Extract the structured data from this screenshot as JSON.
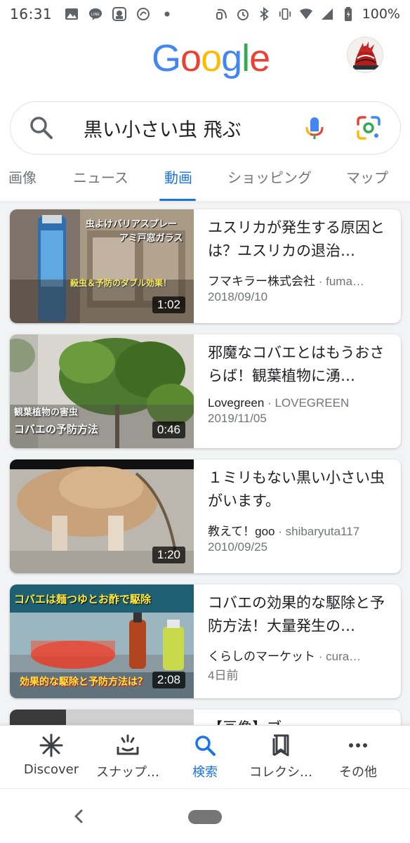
{
  "statusbar": {
    "time": "16:31",
    "battery": "100%"
  },
  "header": {
    "logo": [
      "G",
      "o",
      "o",
      "g",
      "l",
      "e"
    ],
    "logo_colors": [
      "#4285F4",
      "#EA4335",
      "#FBBC05",
      "#4285F4",
      "#34A853",
      "#EA4335"
    ]
  },
  "search": {
    "query": "黒い小さい虫 飛ぶ"
  },
  "tabs": [
    {
      "label": "画像"
    },
    {
      "label": "ニュース"
    },
    {
      "label": "動画",
      "active": true
    },
    {
      "label": "ショッピング"
    },
    {
      "label": "マップ"
    }
  ],
  "results": [
    {
      "title": "ユスリカが発生する原因とは？ユスリカの退治…",
      "source": "フマキラー株式会社",
      "handle": "fuma…",
      "date": "2018/09/10",
      "duration": "1:02",
      "thumb_text": [
        "虫よけバリアスプレー",
        "アミ戸窓ガラス",
        "殺虫＆予防のダブル効果！"
      ]
    },
    {
      "title": "邪魔なコバエとはもうおさらば！観葉植物に湧…",
      "source": "Lovegreen",
      "handle": "LOVEGREEN",
      "date": "2019/11/05",
      "duration": "0:46",
      "thumb_text": [
        "観葉植物の害虫",
        "コバエの予防方法"
      ]
    },
    {
      "title": "１ミリもない黒い小さい虫がいます。",
      "source": "教えて！goo",
      "handle": "shibaryuta117",
      "date": "2010/09/25",
      "duration": "1:20",
      "thumb_text": []
    },
    {
      "title": "コバエの効果的な駆除と予防方法！大量発生の…",
      "source": "くらしのマーケット",
      "handle": "cura…",
      "date": "4日前",
      "duration": "2:08",
      "thumb_text": [
        "コバエは麺つゆとお酢で駆除",
        "効果的な駆除と予防方法は？"
      ]
    },
    {
      "title": "【画像】ブ…",
      "source": "",
      "handle": "",
      "date": "",
      "duration": "",
      "thumb_text": []
    }
  ],
  "bottomnav": [
    {
      "label": "Discover",
      "icon": "discover-asterisk-icon"
    },
    {
      "label": "スナップ…",
      "icon": "snapshot-icon"
    },
    {
      "label": "検索",
      "icon": "search-icon",
      "active": true
    },
    {
      "label": "コレクシ…",
      "icon": "collections-icon"
    },
    {
      "label": "その他",
      "icon": "more-dots-icon"
    }
  ]
}
